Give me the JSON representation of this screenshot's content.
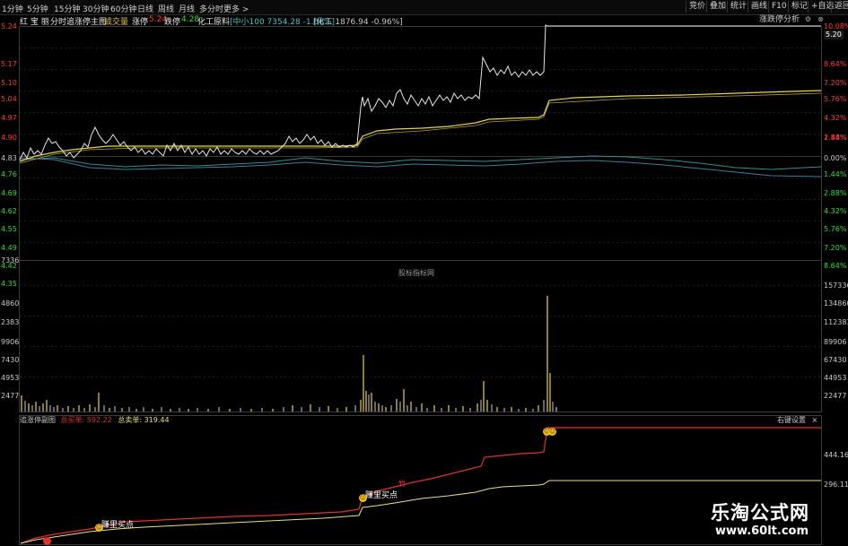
{
  "toolbar": {
    "periods": [
      "1分钟",
      "5分钟",
      "15分钟",
      "30分钟",
      "60分钟",
      "日线",
      "周线",
      "月线",
      "多分时",
      "更多 >"
    ],
    "right_buttons": [
      "竞价",
      "叠加",
      "统计",
      "画线",
      "F10",
      "标记",
      "+自选",
      "返回"
    ]
  },
  "info_bar": {
    "stock_name": "红 宝 丽",
    "view": "分时",
    "indicator": "追涨停主图",
    "volume_label": "成交量",
    "limit_up_label": "涨停",
    "limit_up_value": "5.24",
    "limit_down_label": "跌停",
    "limit_down_value": "4.28",
    "sector_label": "化工原料",
    "index1": "[中小100 7354.28 -1.66%]",
    "index2": "[化工 1876.94 -0.96%]",
    "analysis_button": "涨跌停分析",
    "settings_icon": "gear-icon",
    "close_icon": "close-icon",
    "up_label_color": "#ff3b3b",
    "down_label_color": "#33dd33"
  },
  "price_axis": {
    "left_prices": [
      "5.24",
      "5.17",
      "5.10",
      "5.04",
      "4.97",
      "4.90",
      "4.83",
      "4.76",
      "4.69",
      "4.62",
      "4.55",
      "4.49",
      "4.42",
      "4.35"
    ],
    "right_percents": [
      "10.08%",
      "8.64%",
      "7.20%",
      "5.76%",
      "4.32%",
      "2.88%",
      "1.44%",
      "0.00%",
      "1.44%",
      "2.88%",
      "4.32%",
      "5.76%",
      "7.20%",
      "8.64%"
    ],
    "current_price_tag": "5.20"
  },
  "volume_axis": {
    "left": [
      "7336",
      "4860",
      "2383",
      "9906",
      "7430",
      "4953",
      "2477"
    ],
    "right": [
      "157336",
      "134860",
      "112383",
      "89906",
      "67430",
      "44953",
      "22477"
    ]
  },
  "watermark": "股标指标网",
  "sub_panel": {
    "title": "追涨停副图",
    "buy_label": "总买单:",
    "buy_value": "592.22",
    "sell_label": "总卖单:",
    "sell_value": "319.44",
    "right_key": "右键设置",
    "close_glyph": "×",
    "axis_right": [
      "444.16",
      "296.11"
    ],
    "markers": [
      "赚里买点",
      "赚里买点",
      "竹"
    ]
  },
  "logo": {
    "text": "乐淘公式网",
    "url": "www.60lt.com"
  }
}
